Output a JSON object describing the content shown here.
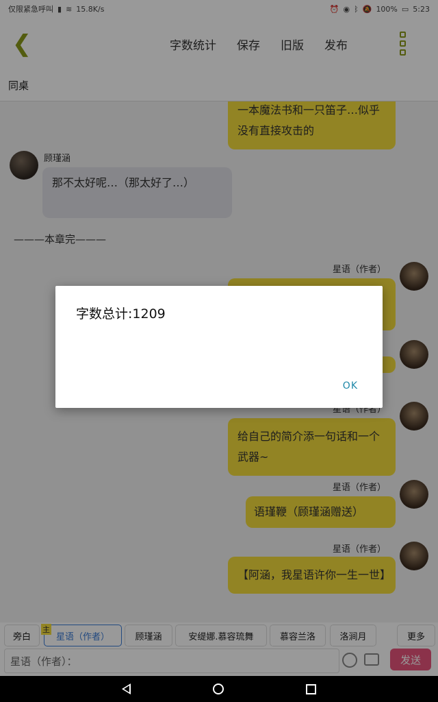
{
  "status": {
    "carrier": "仅限紧急呼叫",
    "speed": "15.8K/s",
    "battery": "100%",
    "time": "5:23"
  },
  "toolbar": {
    "back_icon": "chevron-left-icon",
    "actions": [
      "字数统计",
      "保存",
      "旧版",
      "发布"
    ],
    "more_icon": "more-dots-icon"
  },
  "chapter": {
    "title": "同桌"
  },
  "messages": [
    {
      "side": "right",
      "name": "",
      "text": "一本魔法书和一只笛子…似乎没有直接攻击的"
    },
    {
      "side": "left",
      "name": "顾瑾涵",
      "text": "那不太好呢…（那太好了…）"
    },
    {
      "side": "right",
      "name": "星语（作者）",
      "text": ""
    },
    {
      "side": "right",
      "name": "",
      "text": ""
    },
    {
      "side": "right",
      "name": "星语（作者）",
      "text": "给自己的简介添一句话和一个武器~"
    },
    {
      "side": "right",
      "name": "星语（作者）",
      "text": "语瑾鞭（顾瑾涵赠送）"
    },
    {
      "side": "right",
      "name": "星语（作者）",
      "text": "【阿涵，我星语许你一生一世】"
    }
  ],
  "chapter_end": "———本章完———",
  "tabs": {
    "badge": "主",
    "items": [
      "旁白",
      "星语（作者）",
      "顾瑾涵",
      "安缇娜.慕容琉舞",
      "慕容兰洛",
      "洛涧月",
      "更多"
    ]
  },
  "input": {
    "placeholder": "星语（作者）：",
    "send_label": "发送"
  },
  "dialog": {
    "title": "字数总计:1209",
    "ok_label": "OK"
  }
}
